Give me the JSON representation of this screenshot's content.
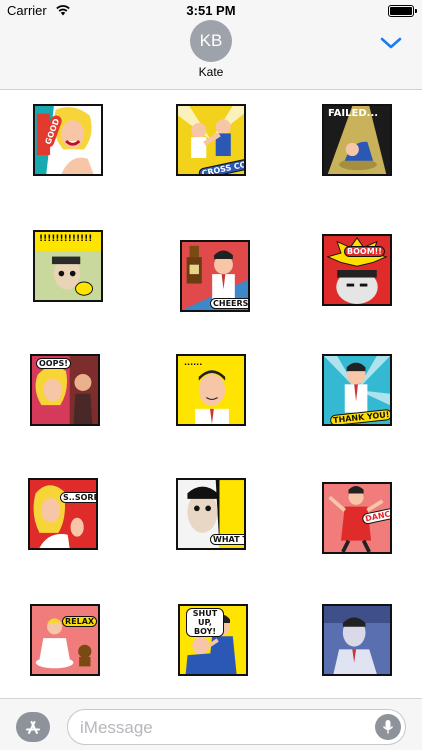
{
  "status_bar": {
    "carrier": "Carrier",
    "time": "3:51 PM"
  },
  "conversation": {
    "avatar_initials": "KB",
    "contact_name": "Kate"
  },
  "stickers": [
    {
      "name": "good",
      "caption": "GOOD",
      "bg": "#19a9b0"
    },
    {
      "name": "cross-counter",
      "caption": "CROSS COUNTER!",
      "bg": "#f2d21b"
    },
    {
      "name": "failed",
      "caption": "FAILED...",
      "bg": "#1b1b1b"
    },
    {
      "name": "surprised",
      "caption": "!!!!!!!!!!!!!",
      "bg": "#ffe400"
    },
    {
      "name": "cheers",
      "caption": "CHEERS!!!",
      "bg": "#3c88c8"
    },
    {
      "name": "boom",
      "caption": "BOOM!!",
      "bg": "#e02b2b"
    },
    {
      "name": "oops",
      "caption": "OOPS!",
      "bg": "#d63a5a"
    },
    {
      "name": "ellipsis",
      "caption": "......",
      "bg": "#ffe400"
    },
    {
      "name": "thank-you",
      "caption": "THANK YOU!",
      "bg": "#35b9d3"
    },
    {
      "name": "sorry",
      "caption": "S..SORRY...",
      "bg": "#e02b2b"
    },
    {
      "name": "what-the",
      "caption": "WHAT THE...",
      "bg": "#111111"
    },
    {
      "name": "dance",
      "caption": "DANCE!",
      "bg": "#f07c7c"
    },
    {
      "name": "relax",
      "caption": "RELAX",
      "bg": "#f07c7c"
    },
    {
      "name": "shut-up-boy",
      "caption": "SHUT UP, BOY!",
      "bg": "#ffe400"
    },
    {
      "name": "tired",
      "caption": "",
      "bg": "#5a6fb0"
    }
  ],
  "input": {
    "placeholder": "iMessage"
  },
  "colors": {
    "accent": "#1a7cf5",
    "header_bg": "#f6f6f7",
    "avatar_bg": "#9da2ab"
  },
  "icons": {
    "wifi": "wifi-icon",
    "battery": "battery-icon",
    "chevron": "chevron-down-icon",
    "appstore": "app-store-icon",
    "mic": "microphone-icon"
  }
}
